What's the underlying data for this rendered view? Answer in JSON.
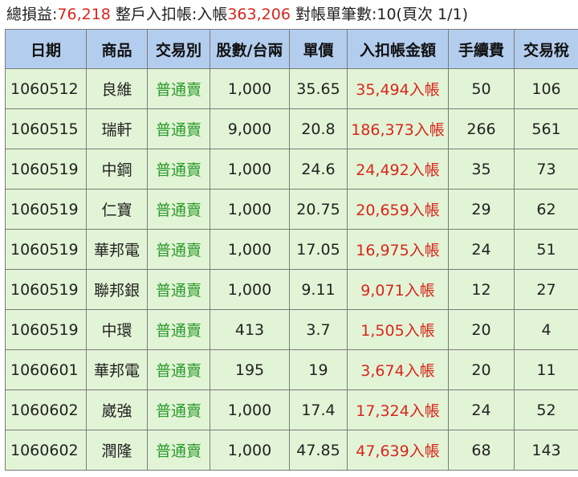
{
  "summary": {
    "loss_label": "總損益:",
    "loss_value": "76,218",
    "account_label": " 整戶入扣帳:入帳",
    "account_value": "363,206",
    "count_text": " 對帳單筆數:10(頁次 1/1)"
  },
  "table": {
    "headers": [
      "日期",
      "商品",
      "交易別",
      "股數/台兩",
      "單價",
      "入扣帳金額",
      "手續費",
      "交易稅"
    ],
    "rows": [
      {
        "date": "1060512",
        "product": "良維",
        "type": "普通賣",
        "shares": "1,000",
        "price": "35.65",
        "amount": "35,494入帳",
        "fee": "50",
        "tax": "106"
      },
      {
        "date": "1060515",
        "product": "瑞軒",
        "type": "普通賣",
        "shares": "9,000",
        "price": "20.8",
        "amount": "186,373入帳",
        "fee": "266",
        "tax": "561"
      },
      {
        "date": "1060519",
        "product": "中鋼",
        "type": "普通賣",
        "shares": "1,000",
        "price": "24.6",
        "amount": "24,492入帳",
        "fee": "35",
        "tax": "73"
      },
      {
        "date": "1060519",
        "product": "仁寶",
        "type": "普通賣",
        "shares": "1,000",
        "price": "20.75",
        "amount": "20,659入帳",
        "fee": "29",
        "tax": "62"
      },
      {
        "date": "1060519",
        "product": "華邦電",
        "type": "普通賣",
        "shares": "1,000",
        "price": "17.05",
        "amount": "16,975入帳",
        "fee": "24",
        "tax": "51"
      },
      {
        "date": "1060519",
        "product": "聯邦銀",
        "type": "普通賣",
        "shares": "1,000",
        "price": "9.11",
        "amount": "9,071入帳",
        "fee": "12",
        "tax": "27"
      },
      {
        "date": "1060519",
        "product": "中環",
        "type": "普通賣",
        "shares": "413",
        "price": "3.7",
        "amount": "1,505入帳",
        "fee": "20",
        "tax": "4"
      },
      {
        "date": "1060601",
        "product": "華邦電",
        "type": "普通賣",
        "shares": "195",
        "price": "19",
        "amount": "3,674入帳",
        "fee": "20",
        "tax": "11"
      },
      {
        "date": "1060602",
        "product": "崴強",
        "type": "普通賣",
        "shares": "1,000",
        "price": "17.4",
        "amount": "17,324入帳",
        "fee": "24",
        "tax": "52"
      },
      {
        "date": "1060602",
        "product": "潤隆",
        "type": "普通賣",
        "shares": "1,000",
        "price": "47.85",
        "amount": "47,639入帳",
        "fee": "68",
        "tax": "143"
      }
    ]
  },
  "colors": {
    "header_bg": "#b3cdee",
    "row_bg": "#e2f4d6",
    "amount_red": "#d9261c",
    "type_green": "#2a9a2a"
  }
}
